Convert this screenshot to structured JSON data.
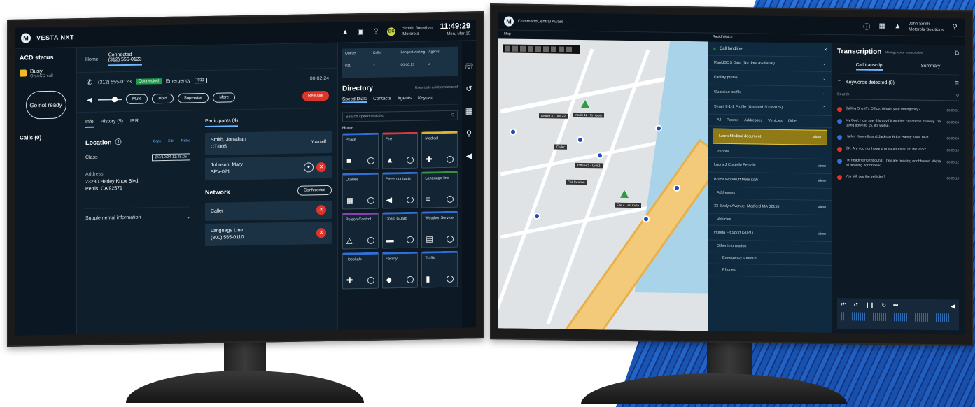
{
  "colors": {
    "accent": "#6db7ff",
    "busy": "#f2b824",
    "danger": "#e0342b",
    "connected": "#1e9e4a",
    "brand_blue": "#1e63c9"
  },
  "left": {
    "brand": "VESTA NXT",
    "user": {
      "initials": "BC",
      "line1": "Smith, Jonathan",
      "line2": "Motorola"
    },
    "clock": {
      "time": "11:49:29",
      "date": "Mon, Mar 10"
    },
    "sidebar": {
      "acd_title": "ACD status",
      "status": "Busy",
      "status_sub": "On ACD call",
      "not_ready": "Go not ready",
      "calls": "Calls (0)"
    },
    "tabs": {
      "home": "Home",
      "call_status": "Connected",
      "call_number": "(312) 555-0123"
    },
    "call": {
      "number": "(312) 555-0123",
      "state": "Connected",
      "type": "Emergency",
      "code": "911",
      "timer": "00:02:24"
    },
    "controls": {
      "mute": "Mute",
      "hold": "Hold",
      "supervise": "Supervise",
      "more": "More",
      "release": "Release"
    },
    "info": {
      "tabs": [
        "Info",
        "History (5)",
        "IRR"
      ],
      "location_title": "Location",
      "actions": [
        "Copy",
        "Edit",
        "Rebid"
      ],
      "class_label": "Class",
      "class_value": "2/3/10/24 11:48:05",
      "address_label": "Address",
      "address_line1": "23230 Harley Knox Blvd,",
      "address_line2": "Perris, CA 92571",
      "supplemental": "Supplemental information"
    },
    "participants": {
      "header": "Participants (4)",
      "list": [
        {
          "name": "Smith, Jonathan",
          "sub": "CT-005",
          "tag": "Yourself"
        },
        {
          "name": "Johnson, Mary",
          "sub": "SPV-021",
          "tag": ""
        }
      ]
    },
    "network": {
      "title": "Network",
      "button": "Conference",
      "items": [
        {
          "name": "Caller",
          "sub": ""
        },
        {
          "name": "Language Line",
          "sub": "(800) 555-0110"
        }
      ]
    },
    "stats": {
      "headers": [
        "Queue",
        "Calls",
        "Longest waiting",
        "Agents"
      ],
      "values": [
        "911",
        "3",
        "00:00:13",
        "4"
      ]
    },
    "directory": {
      "title": "Directory",
      "note": "Uses calls ask/transfer/conf",
      "tabs": [
        "Speed Dials",
        "Contacts",
        "Agents",
        "Keypad"
      ],
      "search_placeholder": "Search speed dials list",
      "group": "Home",
      "dials": [
        {
          "label": "Police",
          "glyph": "■",
          "cls": "d-blue"
        },
        {
          "label": "Fire",
          "glyph": "▲",
          "cls": "d-red"
        },
        {
          "label": "Medical",
          "glyph": "✚",
          "cls": "d-yellow"
        },
        {
          "label": "Utilities",
          "glyph": "▦",
          "cls": "d-blue"
        },
        {
          "label": "Press contacts",
          "glyph": "◀",
          "cls": "d-blue"
        },
        {
          "label": "Language line",
          "glyph": "≡",
          "cls": "d-green"
        },
        {
          "label": "Poison Control",
          "glyph": "△",
          "cls": "d-purple"
        },
        {
          "label": "Coast Guard",
          "glyph": "▬",
          "cls": "d-blue"
        },
        {
          "label": "Weather Service",
          "glyph": "▤",
          "cls": "d-blue"
        },
        {
          "label": "Hospitals",
          "glyph": "✚",
          "cls": "d-blue"
        },
        {
          "label": "Facility",
          "glyph": "◆",
          "cls": "d-blue"
        },
        {
          "label": "Traffic",
          "glyph": "▮",
          "cls": "d-blue"
        }
      ]
    }
  },
  "right": {
    "app_title": "CommandCentral Aware",
    "user": {
      "line1": "John Smith",
      "line2": "Motorola Solutions"
    },
    "map_tab": "Map",
    "map_labels": [
      "Officer 3 - Unit 42",
      "Medic 12 - En route",
      "Caller",
      "Officer 2 - Unit 1",
      "Call location",
      "Fire 4 - en route"
    ],
    "panel": {
      "tab": "Rapid Watch",
      "call_label": "Call landline",
      "rows": [
        "RapidSOS Data (No data available)",
        "Facility profile",
        "Guardian profile",
        "Smart 9-1-1 Profile (Updated 3/10/2025)"
      ],
      "subtabs": [
        "All",
        "People",
        "Addresses",
        "Vehicles",
        "Other"
      ],
      "highlight": "Laura Medical document",
      "people_label": "People",
      "person1": "Laura J Costello  Female",
      "person2": "Bruce Woodruff  Male (29)",
      "addresses_label": "Addresses",
      "address": "33 Evelyn Avenue, Medford MA 02155",
      "vehicles_label": "Vehicles",
      "vehicle": "Honda Fit Sport (2021)",
      "other_label": "Other information",
      "other_items": [
        "Emergency contacts",
        "Phones"
      ],
      "view": "View"
    },
    "transcription": {
      "title": "Transcription",
      "manage": "Manage voice transcription",
      "tabs": [
        "Call transcript",
        "Summary"
      ],
      "keywords": "Keywords detected (0)",
      "search_placeholder": "Search",
      "messages": [
        {
          "text": "Calling Sheriff's Office. What's your emergency?",
          "time": "00:00:01",
          "color": "#e0342b"
        },
        {
          "text": "My God, I just saw this guy hit another car on the freeway. I'm going down to 15, it's worse.",
          "time": "00:00:09",
          "color": "#2f6fd6"
        },
        {
          "text": "Harley Knoxville and Jackson Rd at Harley Knox Blvd.",
          "time": "00:00:09",
          "color": "#2f6fd6"
        },
        {
          "text": "OK. Are you northbound or southbound on the 215?",
          "time": "00:00:10",
          "color": "#e0342b"
        },
        {
          "text": "I'm heading northbound. They are heading northbound. We're all heading northbound.",
          "time": "00:00:12",
          "color": "#2f6fd6"
        },
        {
          "text": "You still see the vehicles?",
          "time": "00:00:15",
          "color": "#e0342b"
        }
      ]
    }
  }
}
